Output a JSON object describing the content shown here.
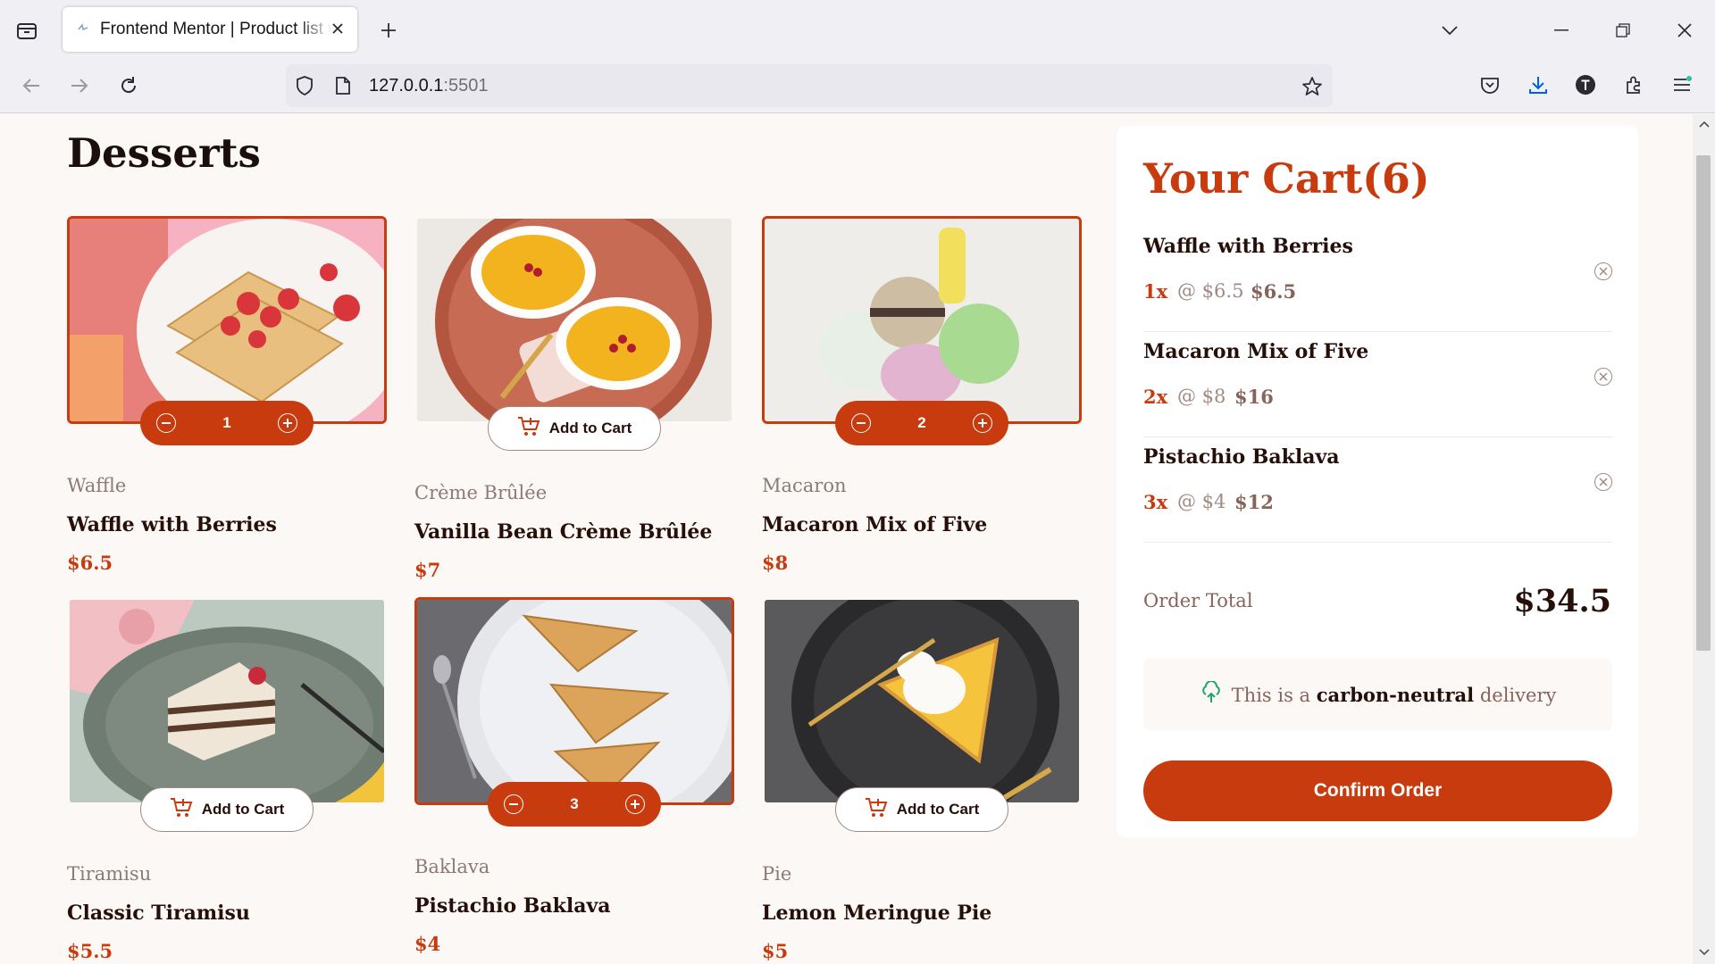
{
  "browser": {
    "tab_title": "Frontend Mentor | Product list with cart",
    "url_host": "127.0.0.1",
    "url_port": ":5501"
  },
  "page": {
    "heading": "Desserts",
    "products": [
      {
        "category": "Waffle",
        "name": "Waffle with Berries",
        "price": "$6.5",
        "in_cart": true,
        "quantity": "1"
      },
      {
        "category": "Crème Brûlée",
        "name": "Vanilla Bean Crème Brûlée",
        "price": "$7",
        "in_cart": false,
        "add_label": "Add to Cart"
      },
      {
        "category": "Macaron",
        "name": "Macaron Mix of Five",
        "price": "$8",
        "in_cart": true,
        "quantity": "2"
      },
      {
        "category": "Tiramisu",
        "name": "Classic Tiramisu",
        "price": "$5.5",
        "in_cart": false,
        "add_label": "Add to Cart"
      },
      {
        "category": "Baklava",
        "name": "Pistachio Baklava",
        "price": "$4",
        "in_cart": true,
        "quantity": "3"
      },
      {
        "category": "Pie",
        "name": "Lemon Meringue Pie",
        "price": "$5",
        "in_cart": false,
        "add_label": "Add to Cart"
      }
    ]
  },
  "cart": {
    "title": "Your Cart(6)",
    "items": [
      {
        "name": "Waffle with Berries",
        "qty": "1x",
        "unit": "@ $6.5",
        "total": "$6.5"
      },
      {
        "name": "Macaron Mix of Five",
        "qty": "2x",
        "unit": "@ $8",
        "total": "$16"
      },
      {
        "name": "Pistachio Baklava",
        "qty": "3x",
        "unit": "@ $4",
        "total": "$12"
      }
    ],
    "order_total_label": "Order Total",
    "order_total_value": "$34.5",
    "carbon_pre": "This is a",
    "carbon_bold": "carbon-neutral",
    "carbon_post": "delivery",
    "confirm_label": "Confirm Order"
  },
  "colors": {
    "accent": "#c73b0f",
    "rose900": "#260f08",
    "rose500": "#87635a",
    "green": "#1ea575"
  }
}
